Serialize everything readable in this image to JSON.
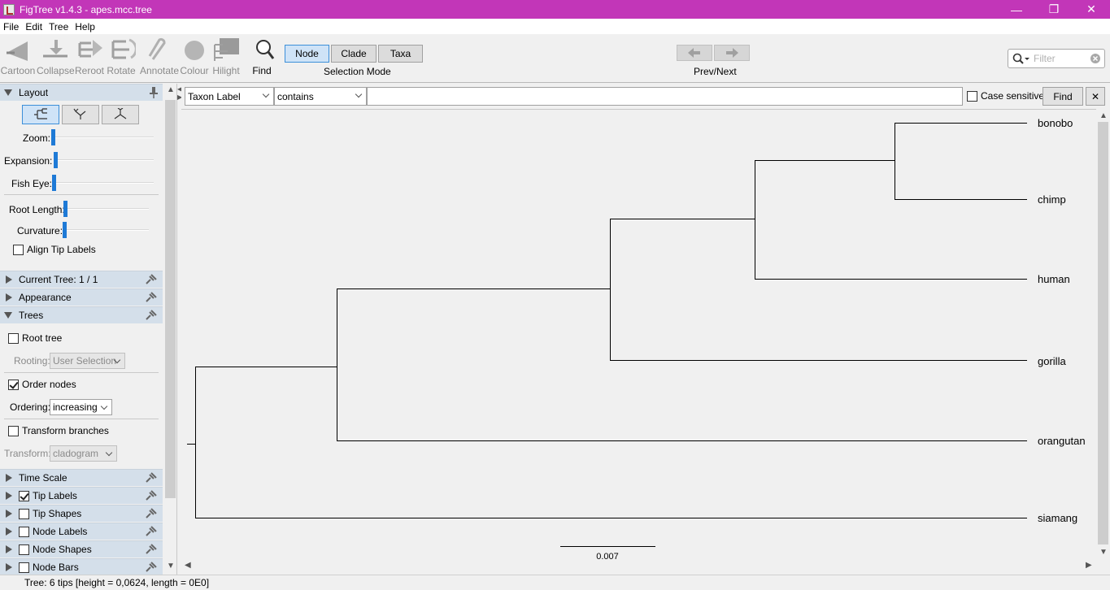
{
  "window": {
    "title": "FigTree v1.4.3 - apes.mcc.tree",
    "minimize": "—",
    "restore": "❐",
    "close": "✕"
  },
  "menu": [
    "File",
    "Edit",
    "Tree",
    "Help"
  ],
  "toolbar": {
    "tools": [
      {
        "label": "Cartoon",
        "icon": "cartoon-icon"
      },
      {
        "label": "Collapse",
        "icon": "collapse-icon"
      },
      {
        "label": "Reroot",
        "icon": "reroot-icon"
      },
      {
        "label": "Rotate",
        "icon": "rotate-icon"
      },
      {
        "label": "Annotate",
        "icon": "annotate-icon"
      },
      {
        "label": "Colour",
        "icon": "colour-icon"
      },
      {
        "label": "Hilight",
        "icon": "hilight-icon"
      },
      {
        "label": "Find",
        "icon": "find-icon"
      }
    ],
    "selection_modes": [
      "Node",
      "Clade",
      "Taxa"
    ],
    "selected_mode": "Node",
    "selection_mode_label": "Selection Mode",
    "prev_next_label": "Prev/Next",
    "filter_placeholder": "Filter"
  },
  "left_panel": {
    "layout": {
      "title": "Layout",
      "zoom_label": "Zoom:",
      "expansion_label": "Expansion:",
      "fisheye_label": "Fish Eye:",
      "root_length_label": "Root Length:",
      "curvature_label": "Curvature:",
      "align_tip_labels": "Align Tip Labels",
      "zoom": 0.0,
      "expansion": 0.0,
      "fisheye": 0.0,
      "root_length": 0.0,
      "curvature": 0.0
    },
    "current_tree": "Current Tree: 1 / 1",
    "appearance": "Appearance",
    "trees": {
      "title": "Trees",
      "root_tree": "Root tree",
      "rooting_label": "Rooting:",
      "rooting_value": "User Selection",
      "order_nodes": "Order nodes",
      "ordering_label": "Ordering:",
      "ordering_value": "increasing",
      "transform_branches": "Transform branches",
      "transform_label": "Transform:",
      "transform_value": "cladogram"
    },
    "sections": [
      {
        "label": "Time Scale",
        "checkbox": null
      },
      {
        "label": "Tip Labels",
        "checkbox": true
      },
      {
        "label": "Tip Shapes",
        "checkbox": false
      },
      {
        "label": "Node Labels",
        "checkbox": false
      },
      {
        "label": "Node Shapes",
        "checkbox": false
      },
      {
        "label": "Node Bars",
        "checkbox": false
      }
    ]
  },
  "search": {
    "field": "Taxon Label",
    "operator": "contains",
    "value": "",
    "case_sensitive": "Case sensitive",
    "find": "Find",
    "close": "✕"
  },
  "tree": {
    "taxa": [
      "bonobo",
      "chimp",
      "human",
      "gorilla",
      "orangutan",
      "siamang"
    ],
    "scale_label": "0.007"
  },
  "status": "Tree: 6 tips [height = 0,0624, length = 0E0]"
}
